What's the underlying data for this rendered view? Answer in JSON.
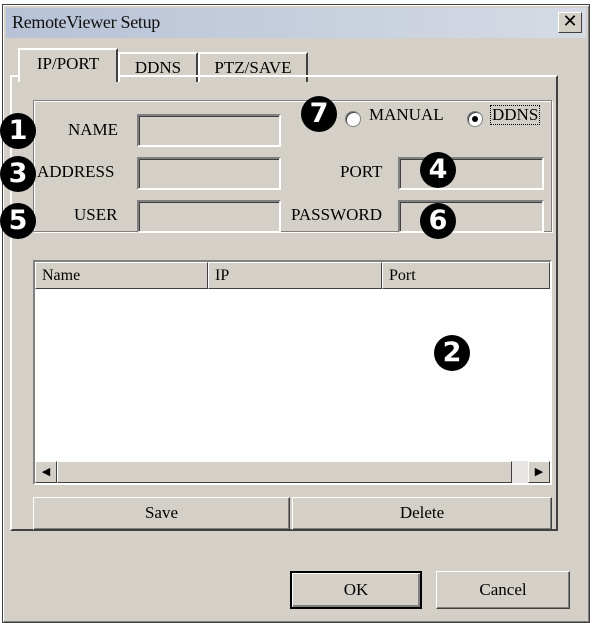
{
  "window": {
    "title": "RemoteViewer Setup",
    "close_glyph": "✕"
  },
  "tabs": [
    {
      "label": "IP/PORT",
      "active": true
    },
    {
      "label": "DDNS",
      "active": false
    },
    {
      "label": "PTZ/SAVE",
      "active": false
    }
  ],
  "mode": {
    "options": [
      {
        "label": "MANUAL",
        "selected": false
      },
      {
        "label": "DDNS",
        "selected": true
      }
    ]
  },
  "fields": {
    "name": {
      "label": "NAME",
      "value": ""
    },
    "address": {
      "label": "ADDRESS",
      "value": ""
    },
    "port": {
      "label": "PORT",
      "value": ""
    },
    "user": {
      "label": "USER",
      "value": ""
    },
    "password": {
      "label": "PASSWORD",
      "value": ""
    }
  },
  "list": {
    "columns": [
      "Name",
      "IP",
      "Port"
    ],
    "rows": []
  },
  "scroll_glyphs": {
    "left": "◀",
    "right": "▶"
  },
  "buttons": {
    "save": "Save",
    "delete": "Delete",
    "ok": "OK",
    "cancel": "Cancel"
  },
  "callouts": [
    "1",
    "2",
    "3",
    "4",
    "5",
    "6",
    "7"
  ],
  "colors": {
    "dialog_bg": "#d4d0c8",
    "title_bar": "#b7c2d6",
    "callout_bg": "#000000"
  }
}
